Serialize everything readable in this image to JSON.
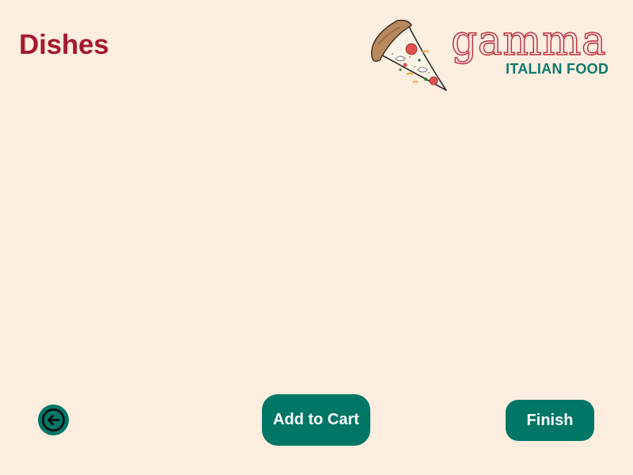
{
  "page": {
    "title": "Dishes"
  },
  "logo": {
    "wordmark": "gamma",
    "subtitle": "ITALIAN FOOD",
    "icon": "pizza-slice-icon"
  },
  "actions": {
    "back_icon": "arrow-left-circle-icon",
    "add_to_cart_label": "Add to Cart",
    "finish_label": "Finish"
  },
  "colors": {
    "background": "#FEEEDF",
    "title": "#A3192B",
    "brand_red": "#BE2E3B",
    "brand_teal": "#0B7A6B",
    "button": "#007667",
    "button_text": "#FFFFFF"
  }
}
